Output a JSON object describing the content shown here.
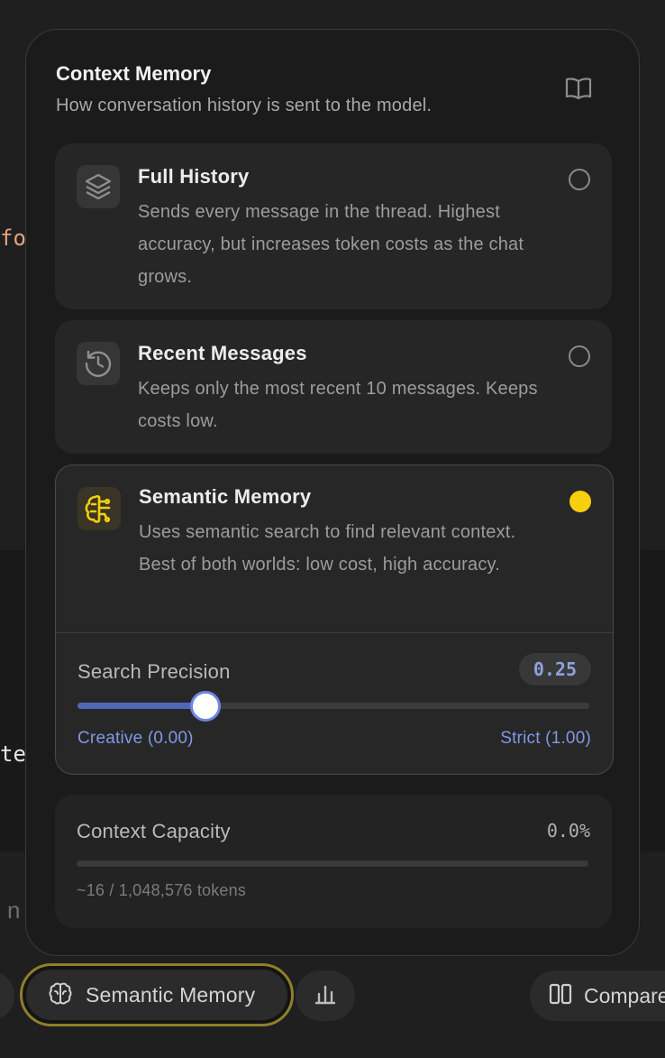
{
  "popover": {
    "title": "Context Memory",
    "subtitle": "How conversation history is sent to the model.",
    "help_icon": "book-icon"
  },
  "options": [
    {
      "title": "Full History",
      "description": "Sends every message in the thread. Highest accuracy, but increases token costs as the chat grows.",
      "icon": "layers-icon",
      "selected": false
    },
    {
      "title": "Recent Messages",
      "description": "Keeps only the most recent 10 messages. Keeps costs low.",
      "icon": "history-icon",
      "selected": false
    },
    {
      "title": "Semantic Memory",
      "description": "Uses semantic search to find relevant context. Best of both worlds: low cost, high accuracy.",
      "icon": "brain-icon",
      "selected": true
    }
  ],
  "search_precision": {
    "label": "Search Precision",
    "value": 0.25,
    "value_text": "0.25",
    "min_label": "Creative (0.00)",
    "max_label": "Strict (1.00)"
  },
  "capacity": {
    "label": "Context Capacity",
    "percent_text": "0.0%",
    "fill_fraction": 0.0,
    "tokens_text": "~16 / 1,048,576 tokens"
  },
  "toolbar": {
    "mode_label": "Semantic Memory",
    "compare_label": "Compare"
  },
  "background": {
    "code_fragment_1": "fo",
    "code_fragment_2": "te",
    "text_fragment": "n"
  },
  "colors": {
    "accent_yellow": "#f7cf0c",
    "accent_blue": "#6e85e3",
    "panel": "#1b1b1b"
  }
}
